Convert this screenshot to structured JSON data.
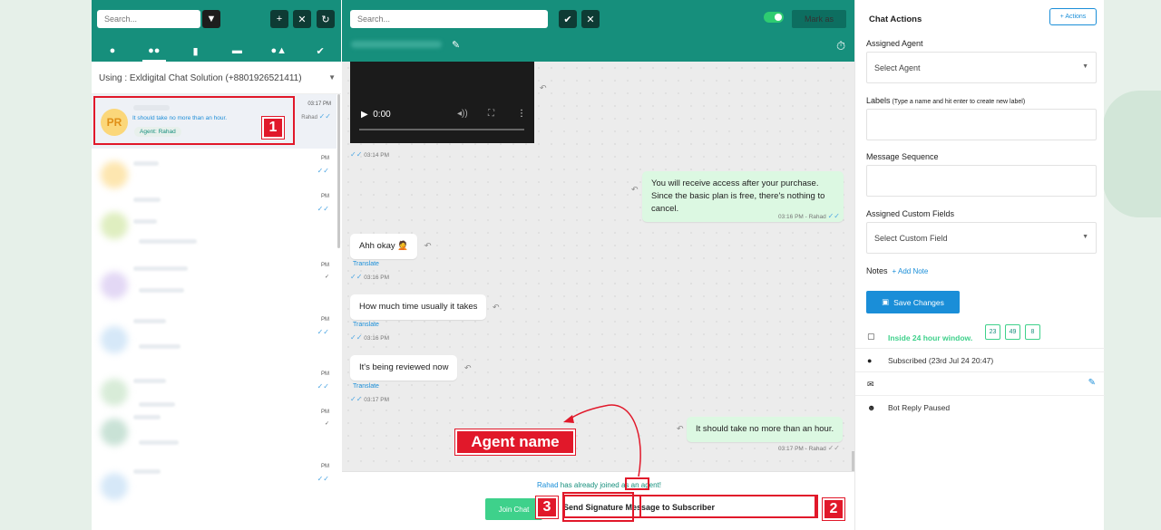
{
  "left": {
    "search_placeholder": "Search...",
    "using": "Using : Exldigital Chat Solution (+8801926521411)",
    "active_chat": {
      "initials": "PR",
      "preview": "It should take no more than an hour.",
      "agent_chip": "Agent: Rahad",
      "time": "03:17 PM",
      "agent": "Rahad"
    },
    "other_chats": [
      {
        "time": "PM"
      },
      {
        "time": "PM"
      },
      {
        "time": "PM"
      },
      {
        "time": "PM"
      },
      {
        "time": "PM"
      },
      {
        "time": "PM"
      },
      {
        "time": "PM"
      }
    ]
  },
  "center": {
    "search_placeholder": "Search...",
    "mark_as": "Mark as",
    "video_time": "0:00",
    "messages": [
      {
        "id": "video-meta",
        "meta": "03:14 PM"
      },
      {
        "id": "m1",
        "dir": "out",
        "text": "You will receive access after your purchase. Since the basic plan is free, there's nothing to cancel.",
        "meta": "03:16 PM - Rahad"
      },
      {
        "id": "m2",
        "dir": "in",
        "text": "Ahh okay 🤦",
        "translate": "Translate",
        "meta": "03:16 PM"
      },
      {
        "id": "m3",
        "dir": "in",
        "text": "How much time usually it takes",
        "translate": "Translate",
        "meta": "03:16 PM"
      },
      {
        "id": "m4",
        "dir": "in",
        "text": "It's being reviewed now",
        "translate": "Translate",
        "meta": "03:17 PM"
      },
      {
        "id": "m5",
        "dir": "out",
        "text": "It should take no more than an hour.",
        "meta": "03:17 PM - Rahad"
      }
    ],
    "joined_agent": "Rahad",
    "joined_text": " has already joined as an agent!",
    "join_button": "Join Chat",
    "signature_label": "Send Signature Message to Subscriber",
    "annotation_label": "Agent name"
  },
  "badges": {
    "one": "1",
    "two": "2",
    "three": "3"
  },
  "right": {
    "title": "Chat Actions",
    "actions_button": "+ Actions",
    "assigned_agent_label": "Assigned Agent",
    "select_agent": "Select Agent",
    "labels_label": "Labels",
    "labels_hint": " (Type a name and hit enter to create new label)",
    "sequence_label": "Message Sequence",
    "custom_fields_label": "Assigned Custom Fields",
    "select_custom_field": "Select Custom Field",
    "notes_label": "Notes",
    "add_note": "+ Add Note",
    "save_button": "Save Changes",
    "window_text": "Inside 24 hour window.",
    "window_counts": [
      "23",
      "49",
      "8"
    ],
    "subscribed": "Subscribed (23rd Jul 24 20:47)",
    "bot_reply": "Bot Reply Paused"
  },
  "colors": {
    "brand": "#168f7c",
    "accent": "#1a8ed8",
    "success": "#3ed18b",
    "annotation": "#e1182a"
  }
}
